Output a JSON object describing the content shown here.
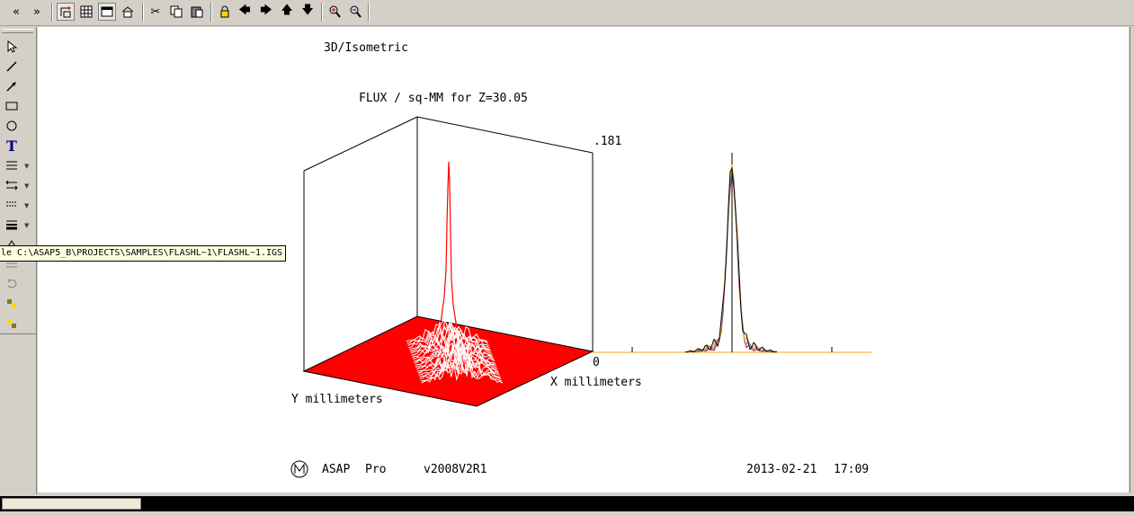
{
  "toolbar": {
    "buttons": [
      "double-chevron-left",
      "double-chevron-right",
      "rotate-view",
      "grid-view",
      "window-view",
      "home",
      "cut",
      "copy",
      "paste",
      "lock",
      "arrow-left",
      "arrow-right",
      "arrow-up",
      "arrow-down",
      "zoom-in",
      "zoom-out"
    ]
  },
  "left_toolbar": {
    "tools": [
      "select-pointer",
      "line",
      "arrow-line",
      "rectangle",
      "ellipse",
      "text",
      "line-style",
      "line-end",
      "dash-style",
      "line-weight",
      "fill",
      "rotate",
      "color-a",
      "color-b"
    ]
  },
  "tooltip": "le C:\\ASAP5_B\\PROJECTS\\SAMPLES\\FLASHL~1\\FLASHL~1.IGS",
  "plot": {
    "view_label": "3D/Isometric",
    "title": "FLUX / sq-MM for Z=30.05",
    "z_max": ".181",
    "z_min": "0",
    "y_axis_label": "Y millimeters",
    "x_axis_label": "X millimeters",
    "surface_color": "#ff0000",
    "profile_colors": [
      "#ff0000",
      "#1e90ff",
      "#ffa500",
      "#000000"
    ]
  },
  "footer": {
    "product": "ASAP",
    "edition": "Pro",
    "version": "v2008V2R1",
    "date": "2013-02-21",
    "time": "17:09"
  }
}
